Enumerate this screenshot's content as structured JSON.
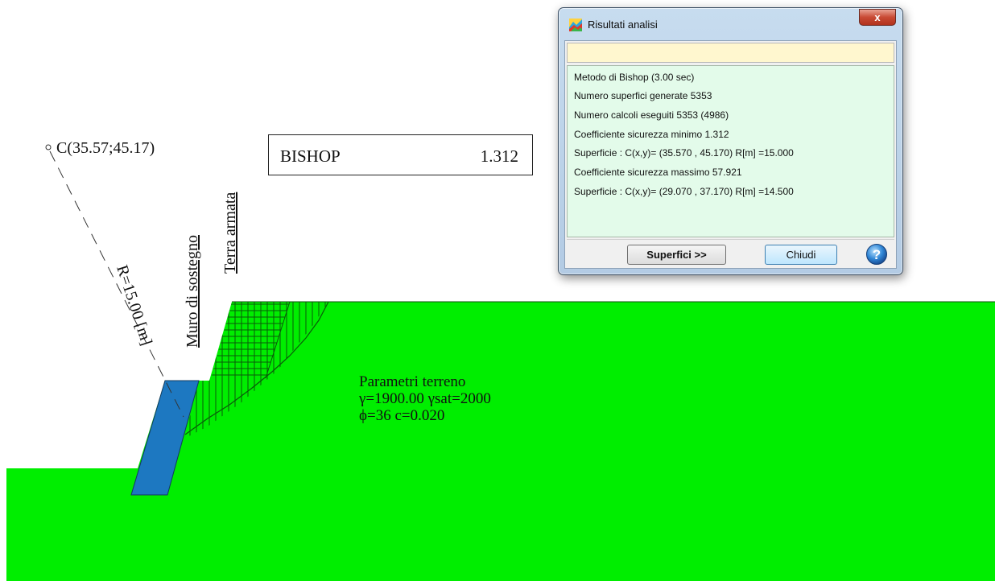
{
  "canvas": {
    "center_label": "C(35.57;45.17)",
    "radius_label": "R=15.00 [m]",
    "wall_label": "Muro di sostegno",
    "reinforced_label": "Terra armata",
    "result": {
      "method": "BISHOP",
      "factor": "1.312"
    },
    "soil": {
      "title": "Parametri terreno",
      "line1": "γ=1900.00   γsat=2000",
      "line2": "ϕ=36  c=0.020"
    },
    "colors": {
      "ground": "#00ee00",
      "wall": "#1d78c1",
      "hatch": "#0a5a0a"
    }
  },
  "dialog": {
    "title": "Risultati analisi",
    "close_glyph": "x",
    "status": "",
    "lines": [
      "Metodo di Bishop (3.00 sec)",
      "Numero superfici generate  5353",
      "Numero calcoli eseguiti  5353 (4986)",
      "Coefficiente sicurezza minimo  1.312",
      "Superficie :  C(x,y)= (35.570 , 45.170)   R[m] =15.000",
      "Coefficiente sicurezza massimo  57.921",
      "Superficie :  C(x,y)= (29.070 , 37.170)   R[m] =14.500"
    ],
    "buttons": {
      "superfici": "Superfici >>",
      "chiudi": "Chiudi"
    },
    "help_glyph": "?"
  }
}
